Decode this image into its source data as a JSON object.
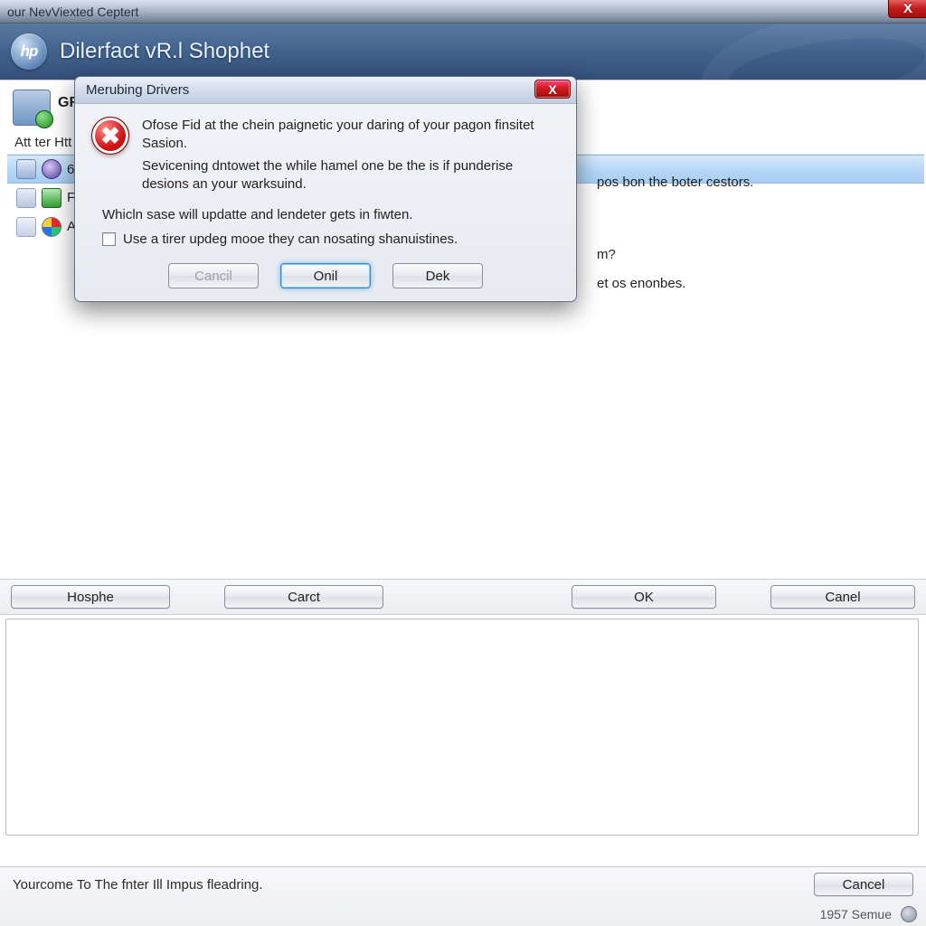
{
  "window": {
    "title": "our NevViexted Ceptert",
    "close_glyph": "X"
  },
  "banner": {
    "logo_text": "hp",
    "title": "Dilerfact vR.l Shophet"
  },
  "heading": {
    "label": "GRS",
    "tail": "pos bon the boter cestors."
  },
  "sub_label": "Att ter Htt",
  "list": {
    "items": [
      {
        "label": "6",
        "tail": ""
      },
      {
        "label": "F",
        "tail": "m?"
      },
      {
        "label": "A",
        "tail": "et os enonbes."
      }
    ]
  },
  "buttons": {
    "hosphe": "Hosphe",
    "carct": "Carct",
    "ok": "OK",
    "canel": "Canel"
  },
  "footer": {
    "status": "Yourcome To The fnter Ill Impus fleadring.",
    "cancel": "Cancel",
    "clock": "1957 Semue"
  },
  "dialog": {
    "title": "Merubing Drivers",
    "close_glyph": "X",
    "error_glyph": "✖",
    "msg_line1": "Ofose Fid at the chein paignetic your daring of your pagon finsitet Sasion.",
    "msg_line2": "Sevicening dntowet the while hamel one be the is if punderise desions an your warksuind.",
    "secondary": "Whicln sase will updatte and lendeter gets in fiwten.",
    "checkbox_label": "Use a tirer updeg mooe they can nosating shanuistines.",
    "btn_cancil": "Cancil",
    "btn_onil": "Onil",
    "btn_dek": "Dek"
  }
}
